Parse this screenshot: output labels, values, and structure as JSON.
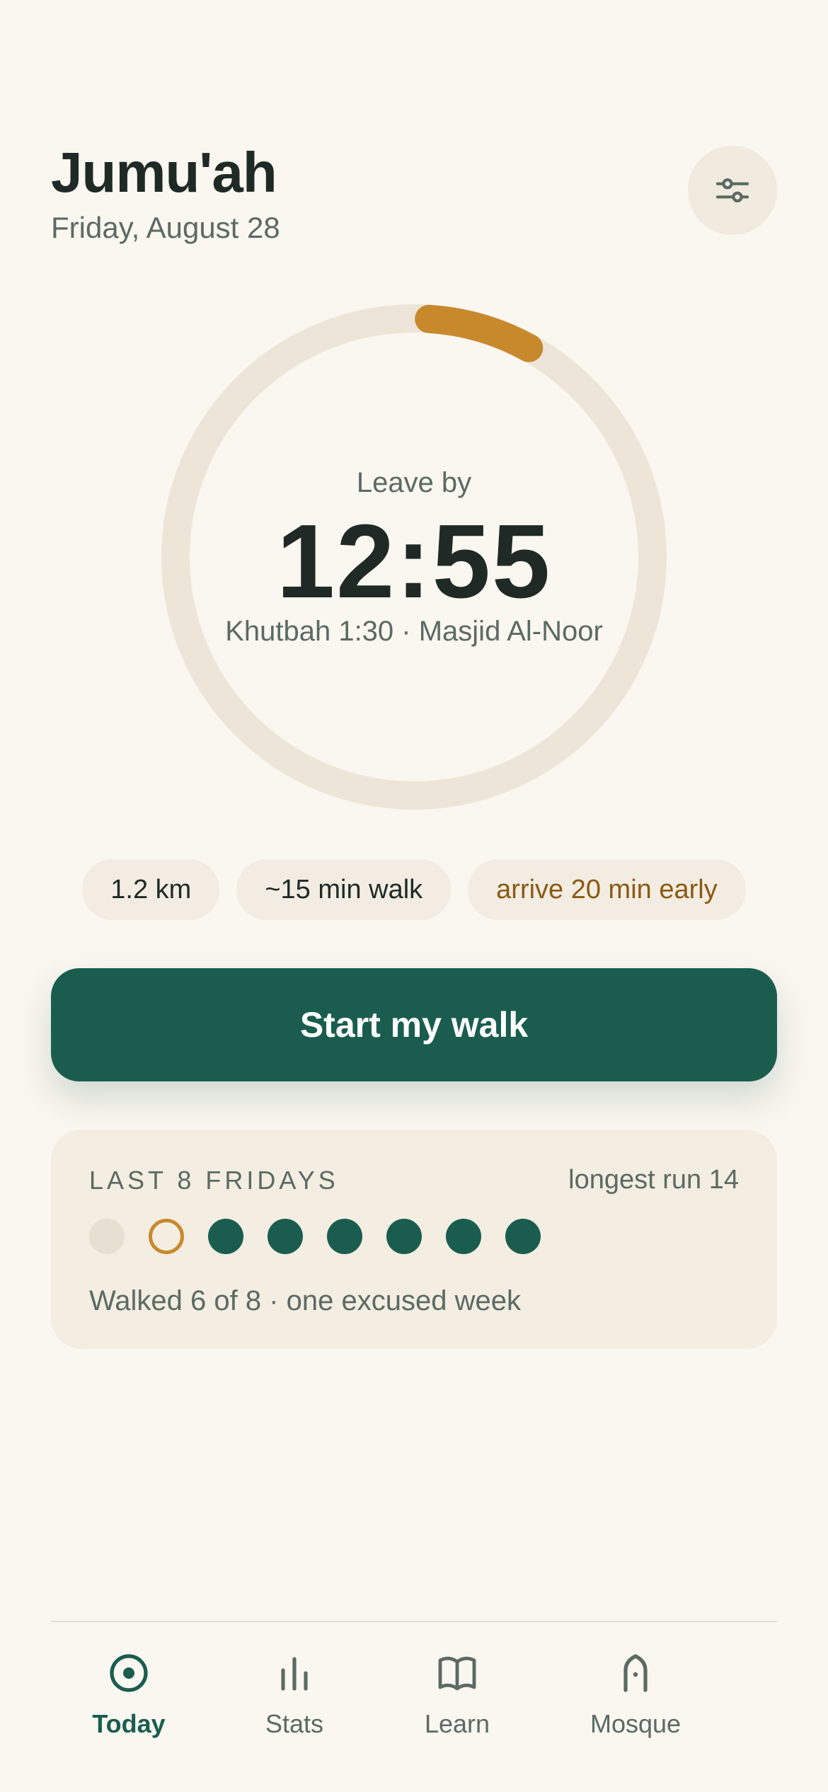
{
  "header": {
    "title": "Jumu'ah",
    "date": "Friday, August 28",
    "settings_icon": "sliders-icon"
  },
  "countdown": {
    "label": "Leave by",
    "time": "12:55",
    "detail": "Khutbah 1:30 · Masjid Al-Noor",
    "progress_fraction": 0.07,
    "ring_color": "#EDE6D8",
    "progress_color": "#C8892D"
  },
  "chips": {
    "distance": "1.2 km",
    "walk_time": "~15 min walk",
    "arrival": "arrive 20 min early"
  },
  "cta": {
    "label": "Start my walk",
    "color": "#1A5D4F"
  },
  "streak": {
    "title": "LAST 8 FRIDAYS",
    "longest_run": "longest run 14",
    "weeks": [
      "missed",
      "excused",
      "walked",
      "walked",
      "walked",
      "walked",
      "walked",
      "walked"
    ],
    "summary": "Walked 6 of 8 · one excused week"
  },
  "nav": {
    "items": [
      {
        "label": "Today",
        "icon": "target-icon",
        "active": true
      },
      {
        "label": "Stats",
        "icon": "bar-chart-icon",
        "active": false
      },
      {
        "label": "Learn",
        "icon": "book-icon",
        "active": false
      },
      {
        "label": "Mosque",
        "icon": "mosque-arch-icon",
        "active": false
      }
    ]
  },
  "colors": {
    "background": "#FAF6F0",
    "primary": "#1A5D4F",
    "accent": "#C8892D",
    "muted_text": "#5B6A63"
  }
}
